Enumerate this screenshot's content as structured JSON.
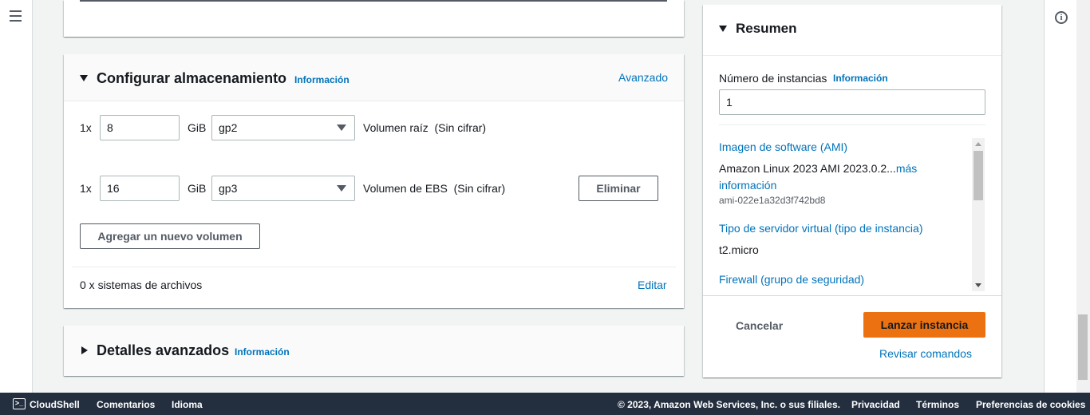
{
  "storage": {
    "title": "Configurar almacenamiento",
    "info": "Información",
    "advanced_link": "Avanzado",
    "volumes": [
      {
        "count": "1x",
        "size": "8",
        "unit": "GiB",
        "type": "gp2",
        "label": "Volumen raíz",
        "encryption": "(Sin cifrar)"
      },
      {
        "count": "1x",
        "size": "16",
        "unit": "GiB",
        "type": "gp3",
        "label": "Volumen de EBS",
        "encryption": "(Sin cifrar)",
        "remove_label": "Eliminar"
      }
    ],
    "add_volume_label": "Agregar un nuevo volumen",
    "filesystems_text": "0 x sistemas de archivos",
    "edit_link": "Editar"
  },
  "advanced": {
    "title": "Detalles avanzados",
    "info": "Información"
  },
  "summary": {
    "title": "Resumen",
    "instances_label": "Número de instancias",
    "info": "Información",
    "instances_value": "1",
    "ami_heading": "Imagen de software (AMI)",
    "ami_name": "Amazon Linux 2023 AMI 2023.0.2...",
    "ami_more_1": "más",
    "ami_more_2": "información",
    "ami_id": "ami-022e1a32d3f742bd8",
    "instance_type_heading": "Tipo de servidor virtual (tipo de instancia)",
    "instance_type_value": "t2.micro",
    "firewall_heading": "Firewall (grupo de seguridad)",
    "cancel_label": "Cancelar",
    "launch_label": "Lanzar instancia",
    "review_label": "Revisar comandos"
  },
  "footer": {
    "cloudshell": "CloudShell",
    "feedback": "Comentarios",
    "language": "Idioma",
    "copyright": "© 2023, Amazon Web Services, Inc. o sus filiales.",
    "privacy": "Privacidad",
    "terms": "Términos",
    "cookies": "Preferencias de cookies"
  },
  "icons": {
    "menu": "hamburger-menu-icon",
    "info": "info-circle-icon",
    "cloudshell": "terminal-icon"
  },
  "colors": {
    "primary_button": "#ec7211",
    "link": "#0073bb",
    "footer_bg": "#232f3e"
  }
}
